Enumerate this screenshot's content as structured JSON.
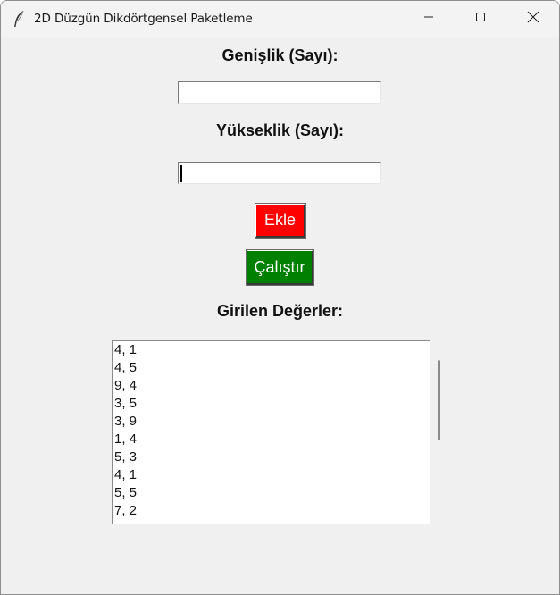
{
  "window": {
    "title": "2D Düzgün Dikdörtgensel Paketleme",
    "icons": {
      "app": "feather-icon",
      "minimize": "minimize-icon",
      "maximize": "maximize-icon",
      "close": "close-icon"
    }
  },
  "form": {
    "width_label": "Genişlik (Sayı):",
    "width_value": "",
    "height_label": "Yükseklik (Sayı):",
    "height_value": "",
    "add_button": "Ekle",
    "run_button": "Çalıştır",
    "list_label": "Girilen Değerler:"
  },
  "values_list": [
    "4, 1",
    "4, 5",
    "9, 4",
    "3, 5",
    "3, 9",
    "1, 4",
    "5, 3",
    "4, 1",
    "5, 5",
    "7, 2"
  ],
  "colors": {
    "add_button_bg": "#ff0000",
    "run_button_bg": "#008000",
    "window_bg": "#f0f0f0"
  }
}
